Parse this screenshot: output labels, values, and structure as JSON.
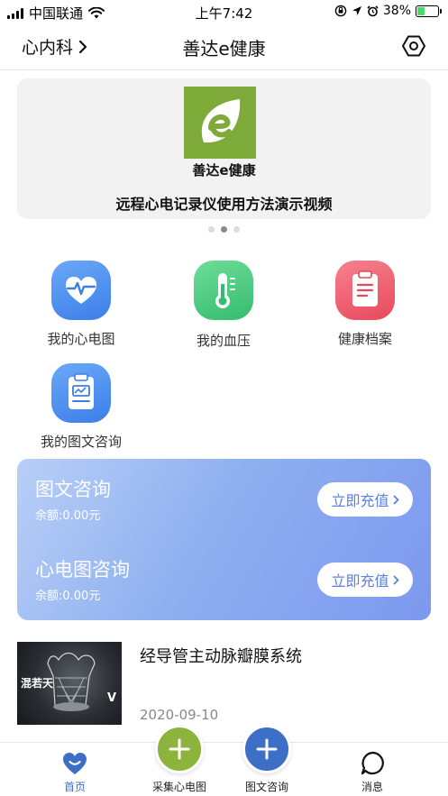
{
  "status_bar": {
    "carrier": "中国联通",
    "time": "上午7:42",
    "battery_percent": "38%",
    "battery_level": 0.38
  },
  "header": {
    "department": "心内科",
    "title": "善达e健康"
  },
  "banner": {
    "logo_name": "善达e健康",
    "caption": "远程心电记录仪使用方法演示视频",
    "page_count": 3,
    "active_page": 2
  },
  "menu": [
    {
      "label": "我的心电图",
      "icon": "heart-ecg-icon",
      "color": "#4a8ef0"
    },
    {
      "label": "我的血压",
      "icon": "thermometer-icon",
      "color": "#3fc77a"
    },
    {
      "label": "健康档案",
      "icon": "clipboard-icon",
      "color": "#ee5a6c"
    },
    {
      "label": "我的图文咨询",
      "icon": "clipboard-chart-icon",
      "color": "#4a8ef0"
    }
  ],
  "consult": {
    "items": [
      {
        "title": "图文咨询",
        "balance": "余额:0.00元",
        "button": "立即充值"
      },
      {
        "title": "心电图咨询",
        "balance": "余额:0.00元",
        "button": "立即充值"
      }
    ]
  },
  "news": {
    "title": "经导管主动脉瓣膜系统",
    "date": "2020-09-10",
    "thumb_text": "混若天",
    "thumb_text_2": "V"
  },
  "tabbar": {
    "tabs": [
      {
        "label": "首页",
        "active": true
      },
      {
        "label": "采集心电图"
      },
      {
        "label": "图文咨询"
      },
      {
        "label": "消息"
      }
    ]
  },
  "colors": {
    "accent_blue": "#3c6fc5",
    "accent_green": "#8cb43c",
    "button_text": "#5b7fe0"
  }
}
